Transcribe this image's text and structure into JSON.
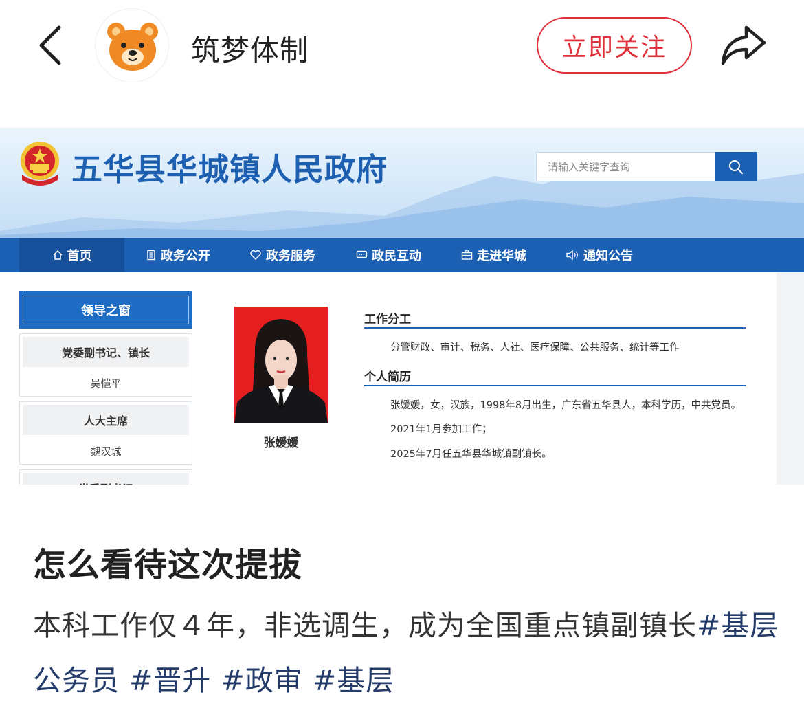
{
  "topbar": {
    "account_name": "筑梦体制",
    "follow_label": "立即关注"
  },
  "site": {
    "title": "五华县华城镇人民政府",
    "search_placeholder": "请输入关键字查询",
    "nav": [
      "首页",
      "政务公开",
      "政务服务",
      "政民互动",
      "走进华城",
      "通知公告"
    ],
    "sidebar": {
      "header": "领导之窗",
      "cards": [
        {
          "title": "党委副书记、镇长",
          "name": "吴恺平"
        },
        {
          "title": "人大主席",
          "name": "魏汉城"
        },
        {
          "title": "党委副书记",
          "name": ""
        }
      ]
    },
    "person_name": "张媛媛",
    "section_duty_title": "工作分工",
    "duty_text": "分管财政、审计、税务、人社、医疗保障、公共服务、统计等工作",
    "section_bio_title": "个人简历",
    "bio_lines": [
      "张媛媛，女，汉族，1998年8月出生，广东省五华县人，本科学历，中共党员。",
      "2021年1月参加工作；",
      "2025年7月任五华县华城镇副镇长。"
    ]
  },
  "post": {
    "title": "怎么看待这次提拔",
    "body_lead": "本科工作仅４年，非选调生，成为全国重点镇副镇长",
    "hashtags": [
      "#基层公务员",
      "#晋升",
      "#政审",
      "#基层"
    ]
  },
  "colors": {
    "accent_red": "#e0303c",
    "site_blue": "#1b60b3",
    "hashtag": "#253c6a"
  }
}
